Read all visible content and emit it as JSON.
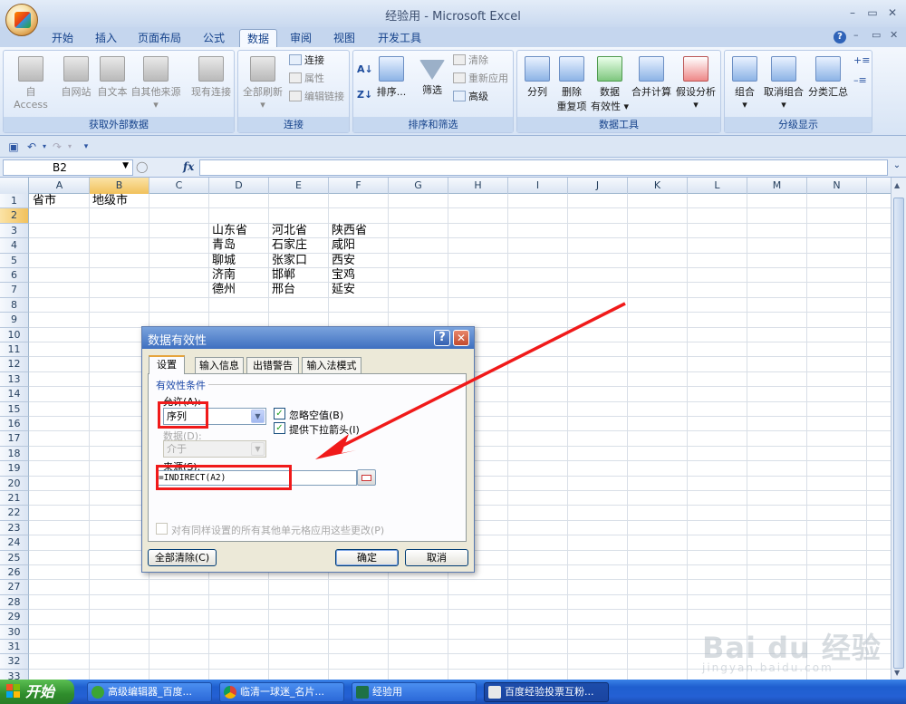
{
  "window": {
    "title": "经验用 - Microsoft Excel"
  },
  "ribbon": {
    "tabs": [
      "开始",
      "插入",
      "页面布局",
      "公式",
      "数据",
      "审阅",
      "视图",
      "开发工具"
    ],
    "active_tab": "数据",
    "groups": {
      "external": {
        "label": "获取外部数据",
        "buttons": [
          "自 Access",
          "自网站",
          "自文本",
          "自其他来源",
          "现有连接"
        ]
      },
      "connections": {
        "label": "连接",
        "refresh": "全部刷新",
        "items": [
          "连接",
          "属性",
          "编辑链接"
        ]
      },
      "sort_filter": {
        "label": "排序和筛选",
        "sort": "排序...",
        "filter": "筛选",
        "items": [
          "清除",
          "重新应用",
          "高级"
        ]
      },
      "data_tools": {
        "label": "数据工具",
        "buttons": [
          "分列",
          "删除",
          "重复项",
          "数据",
          "有效性",
          "合并计算",
          "假设分析"
        ]
      },
      "outline": {
        "label": "分级显示",
        "buttons": [
          "组合",
          "取消组合",
          "分类汇总"
        ]
      }
    }
  },
  "formula_bar": {
    "name_box": "B2",
    "fx": "fx",
    "formula": ""
  },
  "sheet": {
    "columns": [
      "A",
      "B",
      "C",
      "D",
      "E",
      "F",
      "G",
      "H",
      "I",
      "J",
      "K",
      "L",
      "M",
      "N"
    ],
    "selected_column": "B",
    "selected_row": "2",
    "rows": [
      "1",
      "2",
      "3",
      "4",
      "5",
      "6",
      "7",
      "8",
      "9",
      "10",
      "11",
      "12",
      "13",
      "14",
      "15",
      "16",
      "17",
      "18",
      "19",
      "20",
      "21",
      "22",
      "23",
      "24",
      "25",
      "26",
      "27",
      "28",
      "29",
      "30",
      "31",
      "32",
      "33"
    ],
    "cells": {
      "A1": "省市",
      "B1": "地级市",
      "D3": "山东省",
      "E3": "河北省",
      "F3": "陕西省",
      "D4": "青岛",
      "E4": "石家庄",
      "F4": "咸阳",
      "D5": "聊城",
      "E5": "张家口",
      "F5": "西安",
      "D6": "济南",
      "E6": "邯郸",
      "F6": "宝鸡",
      "D7": "德州",
      "E7": "邢台",
      "F7": "延安"
    }
  },
  "dialog": {
    "title": "数据有效性",
    "tabs": [
      "设置",
      "输入信息",
      "出错警告",
      "输入法模式"
    ],
    "active_tab": "设置",
    "section": "有效性条件",
    "allow_label": "允许(A):",
    "allow_value": "序列",
    "data_label": "数据(D):",
    "data_value": "介于",
    "ignore_blank": "忽略空值(B)",
    "ignore_blank_checked": true,
    "dropdown": "提供下拉箭头(I)",
    "dropdown_checked": true,
    "source_label": "来源(S):",
    "source_value": "=INDIRECT(A2)",
    "apply_all": "对有同样设置的所有其他单元格应用这些更改(P)",
    "apply_all_checked": false,
    "clear_all": "全部清除(C)",
    "ok": "确定",
    "cancel": "取消"
  },
  "watermark": {
    "logo": "Bai du 经验",
    "url": "jingyan.baidu.com"
  },
  "taskbar": {
    "start": "开始",
    "items": [
      "高级编辑器_百度...",
      "临清一球迷_名片...",
      "经验用",
      "百度经验投票互粉..."
    ]
  },
  "colors": {
    "annotation_red": "#f01a1a",
    "ribbon_blue": "#15428b"
  }
}
